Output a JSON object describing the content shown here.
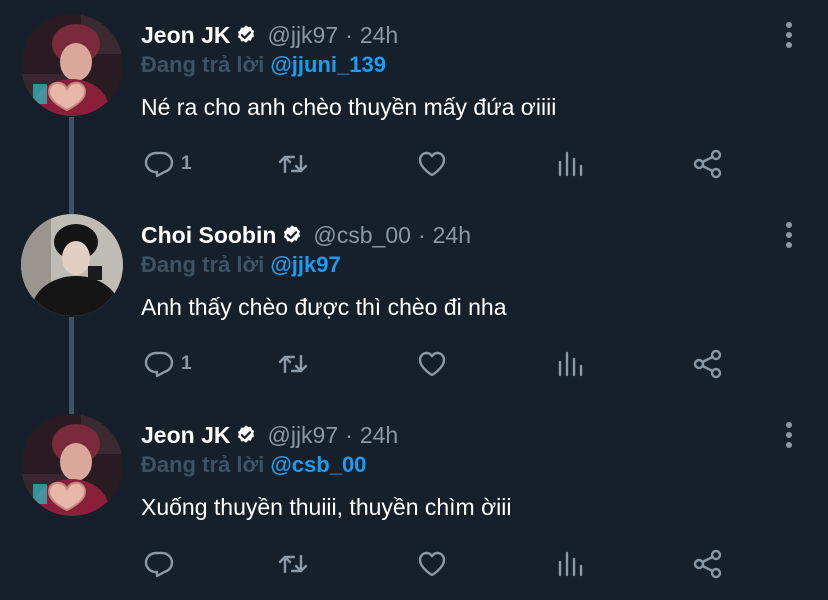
{
  "reply_prefix": "Đang trả lời",
  "colors": {
    "background": "#15202b",
    "muted": "#8b98a5",
    "accent": "#1d9bf0",
    "thread_line": "#3d5466"
  },
  "icons": [
    "verified-badge-icon",
    "more-icon",
    "reply-icon",
    "retweet-icon",
    "like-icon",
    "analytics-icon",
    "share-icon"
  ],
  "tweets": [
    {
      "name": "Jeon JK",
      "handle": "@jjk97",
      "dot": "·",
      "time": "24h",
      "reply_to": "@jjuni_139",
      "text": "Né ra cho anh chèo thuyền mấy đứa ơiiii",
      "reply_count": "1",
      "avatar_desc": "jeon-jk-avatar"
    },
    {
      "name": "Choi Soobin",
      "handle": "@csb_00",
      "dot": "·",
      "time": "24h",
      "reply_to": "@jjk97",
      "text": "Anh thấy chèo được thì chèo đi nha",
      "reply_count": "1",
      "avatar_desc": "choi-soobin-avatar"
    },
    {
      "name": "Jeon JK",
      "handle": "@jjk97",
      "dot": "·",
      "time": "24h",
      "reply_to": "@csb_00",
      "text": "Xuống thuyền thuiii, thuyền chìm ờiii",
      "reply_count": "",
      "avatar_desc": "jeon-jk-avatar"
    }
  ]
}
